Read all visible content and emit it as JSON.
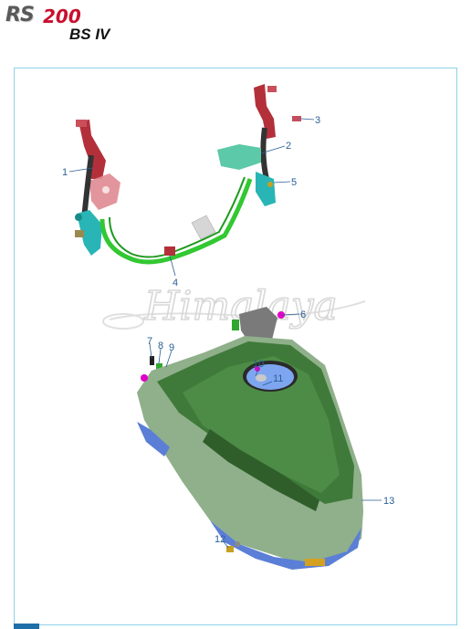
{
  "header": {
    "logo_rs": "RS",
    "logo_number": "200",
    "subtitle": "BS IV"
  },
  "watermark": "Himalaya",
  "callouts": [
    "1",
    "2",
    "3",
    "4",
    "5",
    "6",
    "7",
    "8",
    "9",
    "10",
    "11",
    "12",
    "13"
  ],
  "colors": {
    "frame_border": "#8fd1e6",
    "callout": "#2a5f96",
    "bracket_red": "#b3303a",
    "mount_cyan": "#29b5b5",
    "rail_green": "#32c832",
    "tank_green": "#3f7a3a",
    "tank_shell_green": "#8fb08a",
    "underside_blue": "#5b7fd6",
    "accent_magenta": "#e000c8"
  }
}
